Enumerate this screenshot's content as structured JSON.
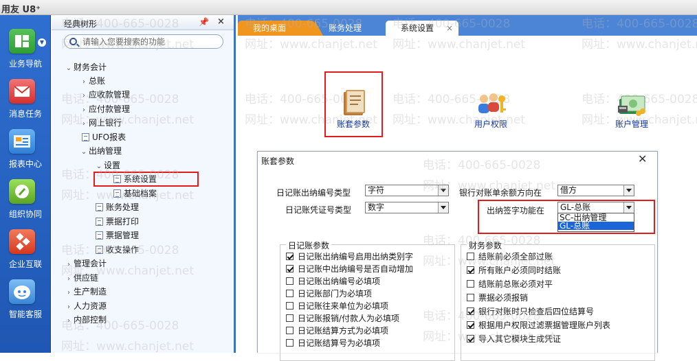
{
  "app": {
    "title": "用友 U8⁺"
  },
  "nav": [
    {
      "label": "业务导航",
      "icon": "business-nav-icon",
      "color": "#2f9e33"
    },
    {
      "label": "消息任务",
      "icon": "message-task-icon",
      "color": "#e03a3a"
    },
    {
      "label": "报表中心",
      "icon": "report-center-icon",
      "color": "#2f7fd8"
    },
    {
      "label": "组织协同",
      "icon": "org-collab-icon",
      "color": "#6dbb2f"
    },
    {
      "label": "企业互联",
      "icon": "enterprise-link-icon",
      "color": "#e0442a"
    },
    {
      "label": "智能客服",
      "icon": "smart-service-icon",
      "color": "#3a86d6"
    }
  ],
  "tree": {
    "title": "经典树形",
    "search_placeholder": "请输入您要搜索的功能",
    "items": [
      {
        "label": "财务会计",
        "arrow": "expanded",
        "level": 0
      },
      {
        "label": "总账",
        "arrow": "collapsed",
        "level": 1
      },
      {
        "label": "应收款管理",
        "arrow": "collapsed",
        "level": 1
      },
      {
        "label": "应付款管理",
        "arrow": "collapsed",
        "level": 1
      },
      {
        "label": "网上银行",
        "arrow": "collapsed",
        "level": 1
      },
      {
        "label": "UFO报表",
        "arrow": "doc",
        "level": 1
      },
      {
        "label": "出纳管理",
        "arrow": "expanded",
        "level": 1
      },
      {
        "label": "设置",
        "arrow": "expanded",
        "level": 2
      },
      {
        "label": "系统设置",
        "arrow": "doc",
        "level": 3
      },
      {
        "label": "基础档案",
        "arrow": "doc",
        "level": 3
      },
      {
        "label": "账务处理",
        "arrow": "doc",
        "level": 2
      },
      {
        "label": "票据打印",
        "arrow": "doc",
        "level": 2
      },
      {
        "label": "票据管理",
        "arrow": "doc",
        "level": 2
      },
      {
        "label": "收支操作",
        "arrow": "doc",
        "level": 2
      },
      {
        "label": "管理会计",
        "arrow": "collapsed",
        "level": 0
      },
      {
        "label": "供应链",
        "arrow": "collapsed",
        "level": 0
      },
      {
        "label": "生产制造",
        "arrow": "collapsed",
        "level": 0
      },
      {
        "label": "人力资源",
        "arrow": "collapsed",
        "level": 0
      },
      {
        "label": "内部控制",
        "arrow": "collapsed",
        "level": 0
      }
    ]
  },
  "tabs": [
    {
      "label": "我的桌面"
    },
    {
      "label": "账务处理"
    },
    {
      "label": "系统设置"
    }
  ],
  "functions": [
    {
      "label": "账套参数",
      "icon": "account-params-icon"
    },
    {
      "label": "用户权限",
      "icon": "user-permission-icon"
    },
    {
      "label": "账户管理",
      "icon": "account-management-icon"
    }
  ],
  "dialog": {
    "title": "账套参数",
    "fields": {
      "journal_number_type_label": "日记账出纳编号类型",
      "journal_number_type_value": "字符",
      "journal_voucher_type_label": "日记账凭证号类型",
      "journal_voucher_type_value": "数字",
      "bank_balance_dir_label": "银行对账单余额方向在",
      "bank_balance_dir_value": "借方",
      "signature_module_label": "出纳签字功能在",
      "signature_module_value": "GL-总账"
    },
    "signature_options": [
      "SC-出纳管理",
      "GL-总账"
    ],
    "journal_group": {
      "title": "日记账参数",
      "options": [
        {
          "label": "日记账出纳编号启用出纳类别字",
          "checked": true
        },
        {
          "label": "日记账中出纳编号是否自动增加",
          "checked": true
        },
        {
          "label": "日记账出纳编号必填项",
          "checked": false
        },
        {
          "label": "日记账部门为必填项",
          "checked": false
        },
        {
          "label": "日记账往来单位为必填项",
          "checked": false
        },
        {
          "label": "日记账报销/付款人为必填项",
          "checked": false
        },
        {
          "label": "日记账结算方式为必填项",
          "checked": false
        },
        {
          "label": "日记账结算号为必填项",
          "checked": false
        }
      ]
    },
    "finance_group": {
      "title": "财务参数",
      "options": [
        {
          "label": "结账前必须全部过账",
          "checked": false
        },
        {
          "label": "所有账户必须同时结账",
          "checked": true
        },
        {
          "label": "结账前总账必须对平",
          "checked": false
        },
        {
          "label": "票据必须报销",
          "checked": false
        },
        {
          "label": "银行对账时只检查后四位结算号",
          "checked": true
        },
        {
          "label": "根据用户权限过滤票据管理账户列表",
          "checked": true
        },
        {
          "label": "导入其它模块生成凭证",
          "checked": true
        }
      ]
    }
  },
  "watermark": {
    "phone": "电话：400-665-0028",
    "site": "网址：www.chanjet.net"
  }
}
